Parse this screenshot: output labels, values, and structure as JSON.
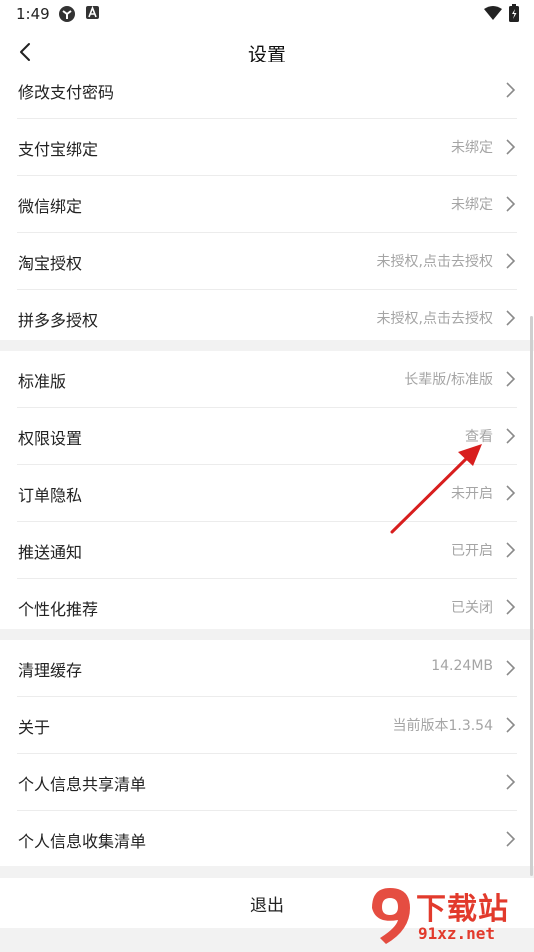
{
  "status_bar": {
    "time": "1:49"
  },
  "header": {
    "title": "设置"
  },
  "sections": [
    {
      "rows": [
        {
          "label": "修改支付密码",
          "value": ""
        },
        {
          "label": "支付宝绑定",
          "value": "未绑定"
        },
        {
          "label": "微信绑定",
          "value": "未绑定"
        },
        {
          "label": "淘宝授权",
          "value": "未授权,点击去授权"
        },
        {
          "label": "拼多多授权",
          "value": "未授权,点击去授权"
        }
      ]
    },
    {
      "rows": [
        {
          "label": "标准版",
          "value": "长辈版/标准版"
        },
        {
          "label": "权限设置",
          "value": "查看"
        },
        {
          "label": "订单隐私",
          "value": "未开启"
        },
        {
          "label": "推送通知",
          "value": "已开启"
        },
        {
          "label": "个性化推荐",
          "value": "已关闭"
        }
      ]
    },
    {
      "rows": [
        {
          "label": "清理缓存",
          "value": "14.24MB"
        },
        {
          "label": "关于",
          "value": "当前版本1.3.54"
        },
        {
          "label": "个人信息共享清单",
          "value": ""
        },
        {
          "label": "个人信息收集清单",
          "value": ""
        }
      ]
    }
  ],
  "logout": {
    "label": "退出"
  },
  "watermark": {
    "text": "下载站",
    "domain": "91xz.net"
  },
  "colors": {
    "annotation_arrow": "#d81e1e",
    "watermark": "#e23a2c"
  }
}
